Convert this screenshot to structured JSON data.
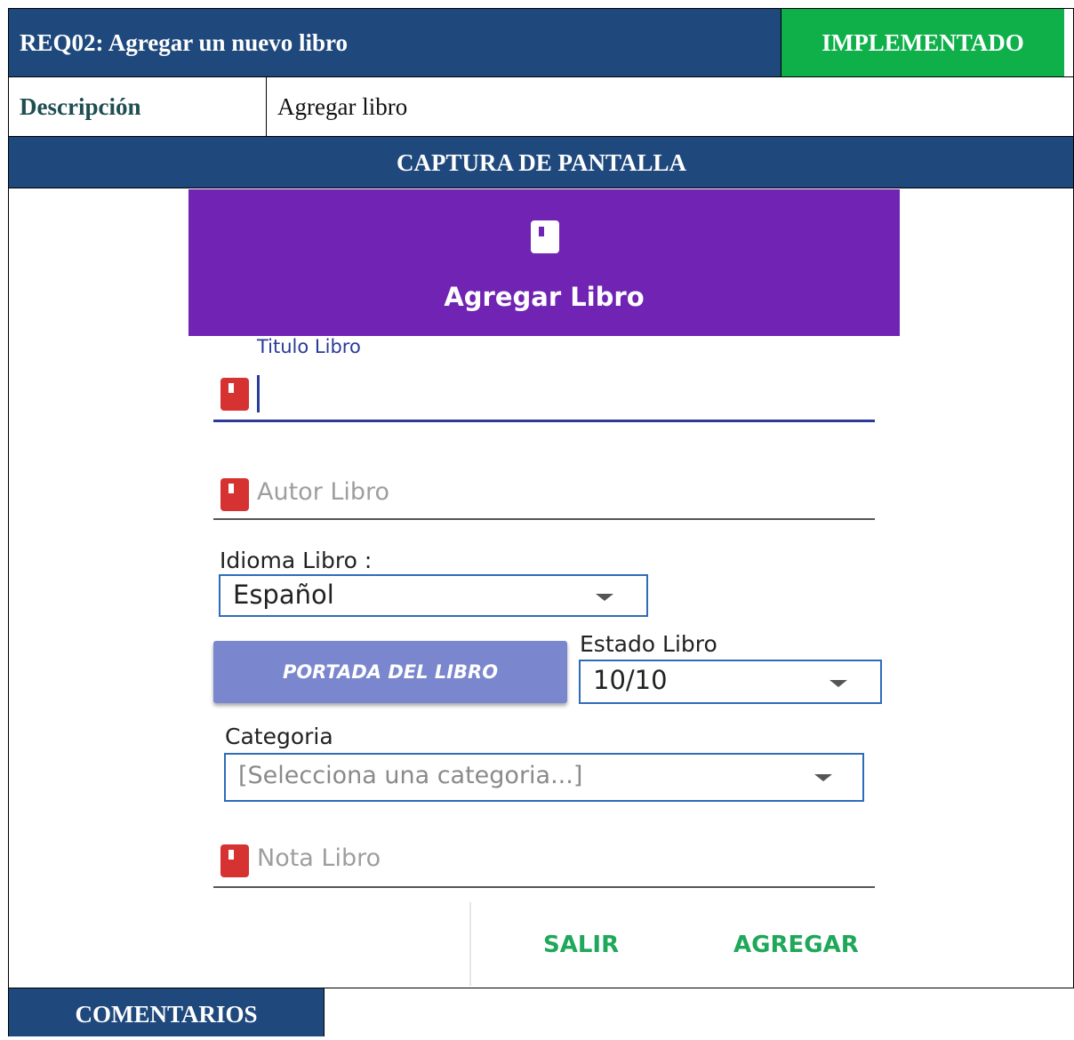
{
  "header": {
    "req_title": "REQ02: Agregar un nuevo libro",
    "status": "IMPLEMENTADO",
    "status_color": "#0fb04a",
    "header_color": "#1f497d"
  },
  "description": {
    "label": "Descripción",
    "value": "Agregar libro"
  },
  "capture_heading": "CAPTURA DE PANTALLA",
  "app": {
    "appbar_color": "#7124b4",
    "title": "Agregar Libro",
    "titulo_field": {
      "label": "Titulo Libro",
      "value": ""
    },
    "autor_field": {
      "placeholder": "Autor Libro"
    },
    "idioma": {
      "label": "Idioma Libro :",
      "selected": "Español"
    },
    "portada_button": "PORTADA DEL LIBRO",
    "estado": {
      "label": "Estado Libro",
      "selected": "10/10"
    },
    "categoria": {
      "label": "Categoria",
      "placeholder": "[Selecciona una categoria...]"
    },
    "nota_field": {
      "placeholder": "Nota Libro"
    },
    "actions": {
      "salir": "SALIR",
      "agregar": "AGREGAR"
    }
  },
  "comments_heading": "COMENTARIOS"
}
